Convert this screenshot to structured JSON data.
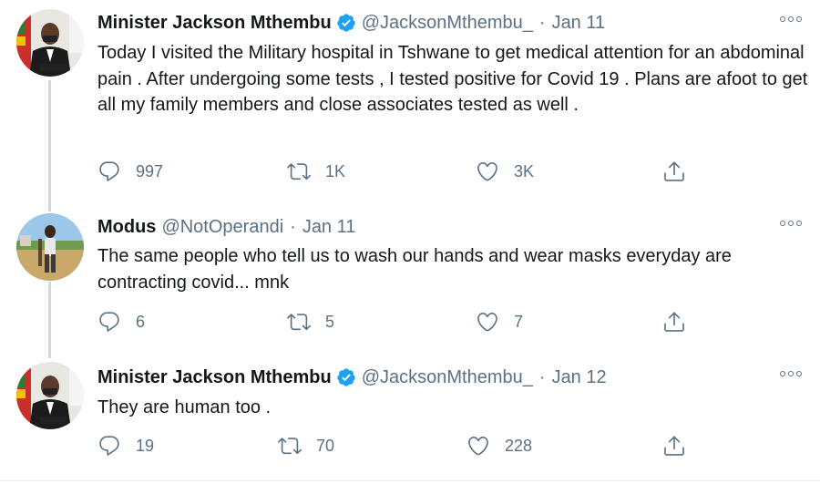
{
  "tweets": [
    {
      "display_name": "Minister Jackson Mthembu",
      "verified": true,
      "handle": "@JacksonMthembu_",
      "separator": "·",
      "date": "Jan 11",
      "text": "Today I visited the Military hospital in Tshwane to get medical attention for an abdominal pain . After undergoing some tests , I tested  positive for Covid 19 . Plans are afoot to get all my family members and close associates tested as well .",
      "replies": "997",
      "retweets": "1K",
      "likes": "3K",
      "avatar": "person-in-suit-avatar"
    },
    {
      "display_name": "Modus",
      "verified": false,
      "handle": "@NotOperandi",
      "separator": "·",
      "date": "Jan 11",
      "text": "The same people who tell us to wash our hands and wear masks everyday are contracting covid... mnk",
      "replies": "6",
      "retweets": "5",
      "likes": "7",
      "avatar": "person-outdoors-avatar"
    },
    {
      "display_name": "Minister Jackson Mthembu",
      "verified": true,
      "handle": "@JacksonMthembu_",
      "separator": "·",
      "date": "Jan 12",
      "text": "They are human too .",
      "replies": "19",
      "retweets": "70",
      "likes": "228",
      "avatar": "person-in-suit-avatar"
    }
  ],
  "icons": {
    "reply": "reply-icon",
    "retweet": "retweet-icon",
    "like": "heart-icon",
    "share": "share-icon",
    "more": "more-options-icon",
    "verified": "verified-badge-icon"
  },
  "colors": {
    "text": "#14171a",
    "secondary": "#5b7083",
    "verified": "#1da1f2",
    "thread_line": "#cfd9de"
  }
}
